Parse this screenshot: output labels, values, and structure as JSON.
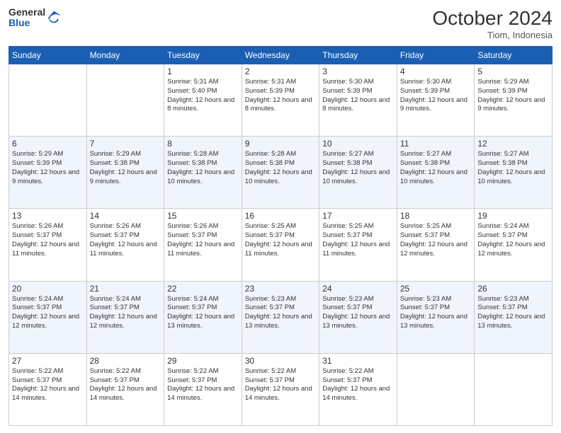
{
  "logo": {
    "line1": "General",
    "line2": "Blue"
  },
  "header": {
    "month_year": "October 2024",
    "location": "Tiom, Indonesia"
  },
  "days_of_week": [
    "Sunday",
    "Monday",
    "Tuesday",
    "Wednesday",
    "Thursday",
    "Friday",
    "Saturday"
  ],
  "weeks": [
    [
      {
        "day": "",
        "info": ""
      },
      {
        "day": "",
        "info": ""
      },
      {
        "day": "1",
        "info": "Sunrise: 5:31 AM\nSunset: 5:40 PM\nDaylight: 12 hours and 8 minutes."
      },
      {
        "day": "2",
        "info": "Sunrise: 5:31 AM\nSunset: 5:39 PM\nDaylight: 12 hours and 8 minutes."
      },
      {
        "day": "3",
        "info": "Sunrise: 5:30 AM\nSunset: 5:39 PM\nDaylight: 12 hours and 8 minutes."
      },
      {
        "day": "4",
        "info": "Sunrise: 5:30 AM\nSunset: 5:39 PM\nDaylight: 12 hours and 9 minutes."
      },
      {
        "day": "5",
        "info": "Sunrise: 5:29 AM\nSunset: 5:39 PM\nDaylight: 12 hours and 9 minutes."
      }
    ],
    [
      {
        "day": "6",
        "info": "Sunrise: 5:29 AM\nSunset: 5:39 PM\nDaylight: 12 hours and 9 minutes."
      },
      {
        "day": "7",
        "info": "Sunrise: 5:29 AM\nSunset: 5:38 PM\nDaylight: 12 hours and 9 minutes."
      },
      {
        "day": "8",
        "info": "Sunrise: 5:28 AM\nSunset: 5:38 PM\nDaylight: 12 hours and 10 minutes."
      },
      {
        "day": "9",
        "info": "Sunrise: 5:28 AM\nSunset: 5:38 PM\nDaylight: 12 hours and 10 minutes."
      },
      {
        "day": "10",
        "info": "Sunrise: 5:27 AM\nSunset: 5:38 PM\nDaylight: 12 hours and 10 minutes."
      },
      {
        "day": "11",
        "info": "Sunrise: 5:27 AM\nSunset: 5:38 PM\nDaylight: 12 hours and 10 minutes."
      },
      {
        "day": "12",
        "info": "Sunrise: 5:27 AM\nSunset: 5:38 PM\nDaylight: 12 hours and 10 minutes."
      }
    ],
    [
      {
        "day": "13",
        "info": "Sunrise: 5:26 AM\nSunset: 5:37 PM\nDaylight: 12 hours and 11 minutes."
      },
      {
        "day": "14",
        "info": "Sunrise: 5:26 AM\nSunset: 5:37 PM\nDaylight: 12 hours and 11 minutes."
      },
      {
        "day": "15",
        "info": "Sunrise: 5:26 AM\nSunset: 5:37 PM\nDaylight: 12 hours and 11 minutes."
      },
      {
        "day": "16",
        "info": "Sunrise: 5:25 AM\nSunset: 5:37 PM\nDaylight: 12 hours and 11 minutes."
      },
      {
        "day": "17",
        "info": "Sunrise: 5:25 AM\nSunset: 5:37 PM\nDaylight: 12 hours and 11 minutes."
      },
      {
        "day": "18",
        "info": "Sunrise: 5:25 AM\nSunset: 5:37 PM\nDaylight: 12 hours and 12 minutes."
      },
      {
        "day": "19",
        "info": "Sunrise: 5:24 AM\nSunset: 5:37 PM\nDaylight: 12 hours and 12 minutes."
      }
    ],
    [
      {
        "day": "20",
        "info": "Sunrise: 5:24 AM\nSunset: 5:37 PM\nDaylight: 12 hours and 12 minutes."
      },
      {
        "day": "21",
        "info": "Sunrise: 5:24 AM\nSunset: 5:37 PM\nDaylight: 12 hours and 12 minutes."
      },
      {
        "day": "22",
        "info": "Sunrise: 5:24 AM\nSunset: 5:37 PM\nDaylight: 12 hours and 13 minutes."
      },
      {
        "day": "23",
        "info": "Sunrise: 5:23 AM\nSunset: 5:37 PM\nDaylight: 12 hours and 13 minutes."
      },
      {
        "day": "24",
        "info": "Sunrise: 5:23 AM\nSunset: 5:37 PM\nDaylight: 12 hours and 13 minutes."
      },
      {
        "day": "25",
        "info": "Sunrise: 5:23 AM\nSunset: 5:37 PM\nDaylight: 12 hours and 13 minutes."
      },
      {
        "day": "26",
        "info": "Sunrise: 5:23 AM\nSunset: 5:37 PM\nDaylight: 12 hours and 13 minutes."
      }
    ],
    [
      {
        "day": "27",
        "info": "Sunrise: 5:22 AM\nSunset: 5:37 PM\nDaylight: 12 hours and 14 minutes."
      },
      {
        "day": "28",
        "info": "Sunrise: 5:22 AM\nSunset: 5:37 PM\nDaylight: 12 hours and 14 minutes."
      },
      {
        "day": "29",
        "info": "Sunrise: 5:22 AM\nSunset: 5:37 PM\nDaylight: 12 hours and 14 minutes."
      },
      {
        "day": "30",
        "info": "Sunrise: 5:22 AM\nSunset: 5:37 PM\nDaylight: 12 hours and 14 minutes."
      },
      {
        "day": "31",
        "info": "Sunrise: 5:22 AM\nSunset: 5:37 PM\nDaylight: 12 hours and 14 minutes."
      },
      {
        "day": "",
        "info": ""
      },
      {
        "day": "",
        "info": ""
      }
    ]
  ]
}
